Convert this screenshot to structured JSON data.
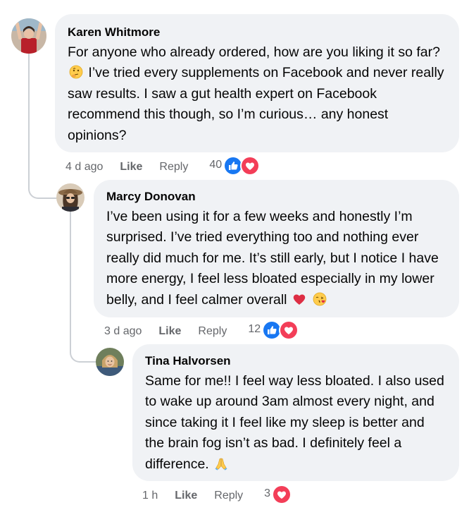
{
  "comments": [
    {
      "author": "Karen Whitmore",
      "text_a": "For anyone who already ordered, how are you liking it so far?",
      "emoji_a": "thinking-face",
      "text_b": " I’ve tried every supplements on Facebook and never really saw results. I saw a gut health expert on Facebook recommend this though, so I’m curious… any honest opinions?",
      "time": "4 d ago",
      "like_label": "Like",
      "reply_label": "Reply",
      "reaction_count": "40",
      "reactions": [
        "like-icon",
        "love-icon"
      ]
    },
    {
      "author": "Marcy Donovan",
      "text_a": "I’ve been using it for a few weeks and honestly I’m surprised. I’ve tried everything too and nothing ever really did much for me. It’s still early, but I notice I have more energy, I feel less bloated especially in my lower belly, and I feel calmer overall",
      "emoji_a": "red-heart",
      "emoji_b": "face-blowing-kiss",
      "time": "3 d ago",
      "like_label": "Like",
      "reply_label": "Reply",
      "reaction_count": "12",
      "reactions": [
        "like-icon",
        "love-icon"
      ]
    },
    {
      "author": "Tina Halvorsen",
      "text_a": "Same for me!! I feel way less bloated. I also used to wake up around 3am almost every night, and since taking it I feel like my sleep is better and the brain fog isn’t as bad. I definitely feel a difference.",
      "emoji_a": "folded-hands",
      "time": "1 h",
      "like_label": "Like",
      "reply_label": "Reply",
      "reaction_count": "3",
      "reactions": [
        "love-icon"
      ]
    }
  ],
  "colors": {
    "bubble": "#f0f2f5",
    "meta_text": "#65676b",
    "like_blue": "#1877f2",
    "love_red": "#f33e58"
  }
}
